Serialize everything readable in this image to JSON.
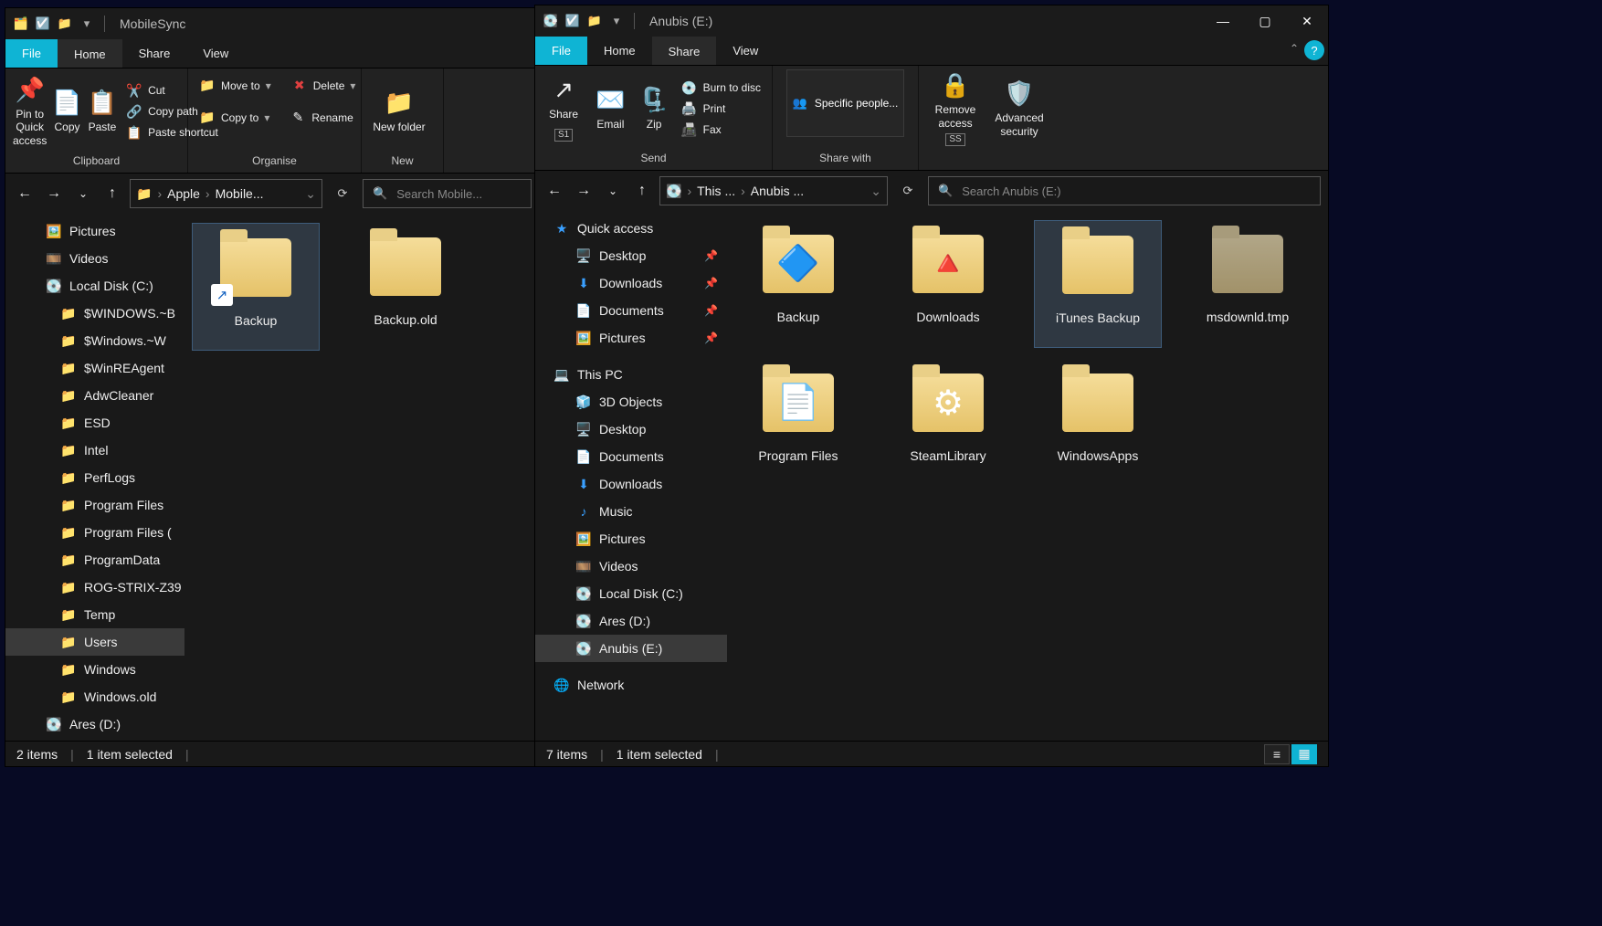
{
  "left": {
    "title": "MobileSync",
    "tabs": {
      "file": "File",
      "home": "Home",
      "share": "Share",
      "view": "View"
    },
    "ribbon": {
      "pin": "Pin to Quick access",
      "copy": "Copy",
      "paste": "Paste",
      "cut": "Cut",
      "copypath": "Copy path",
      "pasteshortcut": "Paste shortcut",
      "group_clipboard": "Clipboard",
      "moveto": "Move to",
      "copyto": "Copy to",
      "delete": "Delete",
      "rename": "Rename",
      "group_organise": "Organise",
      "newfolder": "New folder",
      "group_new": "New"
    },
    "breadcrumb": {
      "seg1": "Apple",
      "seg2": "Mobile..."
    },
    "search_placeholder": "Search Mobile...",
    "nav": [
      {
        "label": "Pictures",
        "icon": "🖼️",
        "depth": 1
      },
      {
        "label": "Videos",
        "icon": "🎞️",
        "depth": 1
      },
      {
        "label": "Local Disk (C:)",
        "icon": "💽",
        "depth": 1
      },
      {
        "label": "$WINDOWS.~B",
        "icon": "📁",
        "depth": 2
      },
      {
        "label": "$Windows.~W",
        "icon": "📁",
        "depth": 2
      },
      {
        "label": "$WinREAgent",
        "icon": "📁",
        "depth": 2
      },
      {
        "label": "AdwCleaner",
        "icon": "📁",
        "depth": 2
      },
      {
        "label": "ESD",
        "icon": "📁",
        "depth": 2
      },
      {
        "label": "Intel",
        "icon": "📁",
        "depth": 2
      },
      {
        "label": "PerfLogs",
        "icon": "📁",
        "depth": 2
      },
      {
        "label": "Program Files",
        "icon": "📁",
        "depth": 2
      },
      {
        "label": "Program Files (",
        "icon": "📁",
        "depth": 2
      },
      {
        "label": "ProgramData",
        "icon": "📁",
        "depth": 2
      },
      {
        "label": "ROG-STRIX-Z39",
        "icon": "📁",
        "depth": 2
      },
      {
        "label": "Temp",
        "icon": "📁",
        "depth": 2
      },
      {
        "label": "Users",
        "icon": "📁",
        "depth": 2,
        "selected": true
      },
      {
        "label": "Windows",
        "icon": "📁",
        "depth": 2
      },
      {
        "label": "Windows.old",
        "icon": "📁",
        "depth": 2
      },
      {
        "label": "Ares (D:)",
        "icon": "💽",
        "depth": 1
      }
    ],
    "items": [
      {
        "label": "Backup",
        "selected": true,
        "overlay": "↗"
      },
      {
        "label": "Backup.old"
      }
    ],
    "status": {
      "count": "2 items",
      "selected": "1 item selected"
    }
  },
  "right": {
    "title": "Anubis (E:)",
    "tabs": {
      "file": "File",
      "home": "Home",
      "share": "Share",
      "view": "View"
    },
    "ribbon": {
      "share": "Share",
      "email": "Email",
      "zip": "Zip",
      "burn": "Burn to disc",
      "print": "Print",
      "fax": "Fax",
      "group_send": "Send",
      "specific": "Specific people...",
      "group_sharewith": "Share with",
      "removeaccess": "Remove access",
      "advanced": "Advanced security",
      "hint_s1": "S1",
      "hint_ss": "SS"
    },
    "breadcrumb": {
      "seg1": "This ...",
      "seg2": "Anubis ..."
    },
    "search_placeholder": "Search Anubis (E:)",
    "nav": [
      {
        "label": "Quick access",
        "icon": "★",
        "depth": 0,
        "color": "#3aa0ff"
      },
      {
        "label": "Desktop",
        "icon": "🖥️",
        "depth": 1,
        "pinned": true
      },
      {
        "label": "Downloads",
        "icon": "⬇",
        "depth": 1,
        "pinned": true,
        "color": "#3aa0ff"
      },
      {
        "label": "Documents",
        "icon": "📄",
        "depth": 1,
        "pinned": true
      },
      {
        "label": "Pictures",
        "icon": "🖼️",
        "depth": 1,
        "pinned": true
      },
      {
        "gap": true
      },
      {
        "label": "This PC",
        "icon": "💻",
        "depth": 0
      },
      {
        "label": "3D Objects",
        "icon": "🧊",
        "depth": 1
      },
      {
        "label": "Desktop",
        "icon": "🖥️",
        "depth": 1
      },
      {
        "label": "Documents",
        "icon": "📄",
        "depth": 1
      },
      {
        "label": "Downloads",
        "icon": "⬇",
        "depth": 1,
        "color": "#3aa0ff"
      },
      {
        "label": "Music",
        "icon": "♪",
        "depth": 1,
        "color": "#3aa0ff"
      },
      {
        "label": "Pictures",
        "icon": "🖼️",
        "depth": 1
      },
      {
        "label": "Videos",
        "icon": "🎞️",
        "depth": 1
      },
      {
        "label": "Local Disk (C:)",
        "icon": "💽",
        "depth": 1
      },
      {
        "label": "Ares (D:)",
        "icon": "💽",
        "depth": 1
      },
      {
        "label": "Anubis (E:)",
        "icon": "💽",
        "depth": 1,
        "selected": true
      },
      {
        "gap": true
      },
      {
        "label": "Network",
        "icon": "🌐",
        "depth": 0
      }
    ],
    "items": [
      {
        "label": "Backup",
        "overlay_center": "🔷"
      },
      {
        "label": "Downloads",
        "overlay_center": "🔺"
      },
      {
        "label": "iTunes Backup",
        "selected": true
      },
      {
        "label": "msdownld.tmp",
        "muted": true
      },
      {
        "label": "Program Files",
        "overlay_center": "📄"
      },
      {
        "label": "SteamLibrary",
        "overlay_center": "⚙"
      },
      {
        "label": "WindowsApps"
      }
    ],
    "status": {
      "count": "7 items",
      "selected": "1 item selected"
    }
  }
}
